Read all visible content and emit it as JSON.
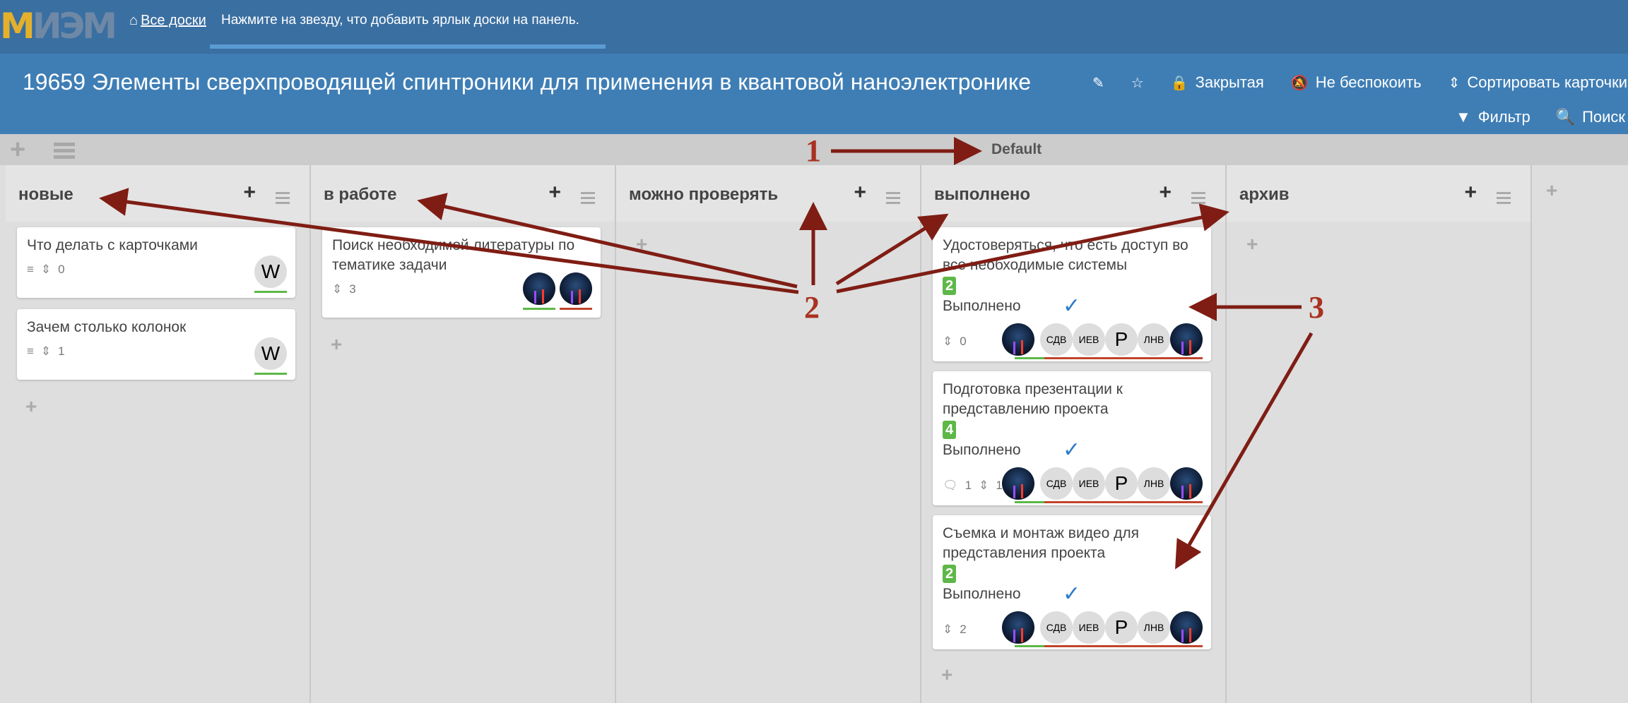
{
  "topbar": {
    "logo_text": "МИЭМ",
    "all_boards_icon": "home-icon",
    "all_boards_label": "Все доски",
    "hint": "Нажмите на звезду, что добавить ярлык доски на панель."
  },
  "board": {
    "title": "19659 Элементы сверхпроводящей спинтроники для применения в квантовой наноэлектронике",
    "actions": [
      {
        "icon": "edit-icon",
        "label": ""
      },
      {
        "icon": "star-icon",
        "label": ""
      },
      {
        "icon": "lock-icon",
        "label": "Закрытая"
      },
      {
        "icon": "bell-slash-icon",
        "label": "Не беспокоить"
      },
      {
        "icon": "sort-icon",
        "label": "Сортировать карточки"
      }
    ],
    "actions_row2": [
      {
        "icon": "filter-icon",
        "label": "Фильтр"
      },
      {
        "icon": "search-icon",
        "label": "Поиск"
      }
    ]
  },
  "swimlane": {
    "title": "Default"
  },
  "lists": [
    {
      "title": "новые",
      "cards": [
        {
          "title": "Что делать с карточками",
          "description_icon": true,
          "subtasks": "0",
          "members": [
            {
              "type": "initial",
              "text": "W"
            }
          ]
        },
        {
          "title": "Зачем столько колонок",
          "description_icon": true,
          "subtasks": "1",
          "members": [
            {
              "type": "initial",
              "text": "W"
            }
          ]
        }
      ]
    },
    {
      "title": "в работе",
      "cards": [
        {
          "title": "Поиск необходимой литературы по тематике задачи",
          "subtasks": "3",
          "members": [
            {
              "type": "avatar"
            },
            {
              "type": "avatar"
            }
          ]
        }
      ]
    },
    {
      "title": "можно проверять",
      "cards": []
    },
    {
      "title": "выполнено",
      "cards": [
        {
          "title": "Удостоверяться, что есть доступ во все необходимые системы",
          "badge": "2",
          "received": "Выполнено",
          "subtasks": "0"
        },
        {
          "title": "Подготовка презентации к представлению проекта",
          "badge": "4",
          "received": "Выполнено",
          "comments": "1",
          "subtasks": "1"
        },
        {
          "title": "Съемка и монтаж видео для представления проекта",
          "badge": "2",
          "received": "Выполнено",
          "subtasks": "2"
        }
      ],
      "members": [
        "avatar",
        "СДВ",
        "ИЕВ",
        "Р",
        "ЛНВ",
        "avatar"
      ]
    },
    {
      "title": "архив",
      "cards": []
    }
  ],
  "annotations": {
    "one": "1",
    "two": "2",
    "three": "3"
  },
  "colors": {
    "header": "#3a6fa1",
    "titlebar": "#3f7eb5",
    "badge": "#5db847",
    "assignee_line": "#5db847",
    "member_line": "#c0452a",
    "annotation": "#7f1d14"
  }
}
